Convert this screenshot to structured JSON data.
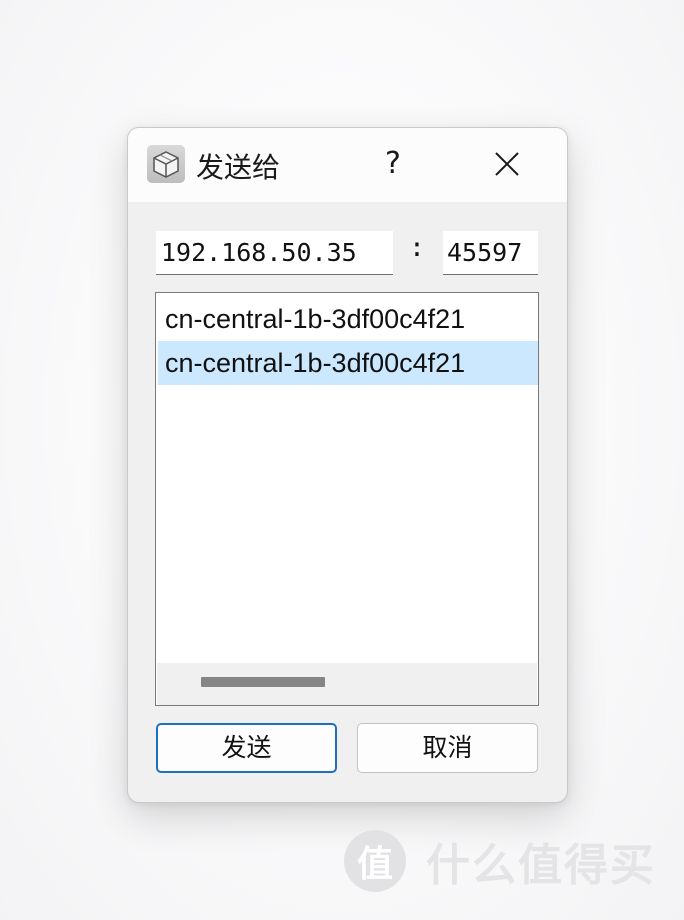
{
  "dialog": {
    "title": "发送给",
    "help_label": "?",
    "close_icon": "close-icon",
    "app_icon": "package-box-icon"
  },
  "address": {
    "ip_value": "192.168.50.35",
    "separator": ":",
    "port_value": "45597"
  },
  "hosts": {
    "items": [
      {
        "label": "cn-central-1b-3df00c4f21",
        "selected": false
      },
      {
        "label": "cn-central-1b-3df00c4f21",
        "selected": true
      }
    ]
  },
  "buttons": {
    "send_label": "发送",
    "cancel_label": "取消"
  },
  "watermark": {
    "logo_char": "值",
    "text": "什么值得买"
  },
  "colors": {
    "selection": "#cce8ff",
    "default_button_border": "#1f6fbf",
    "titlebar": "#fcfcfd",
    "window_body": "#f0f0f1"
  }
}
